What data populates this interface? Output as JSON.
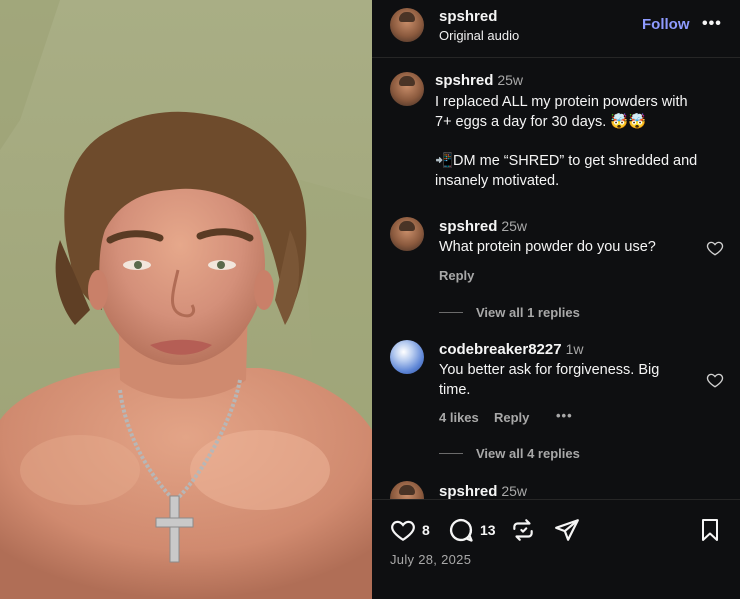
{
  "post": {
    "author": "spshred",
    "audio": "Original audio",
    "follow_label": "Follow",
    "caption_time": "25w",
    "caption_line1": "I replaced ALL my protein powders with",
    "caption_line2": "7+ eggs a day for 30 days. 🤯🤯",
    "caption_line3": "📲DM me “SHRED” to get shredded and",
    "caption_line4": "insanely motivated."
  },
  "comments": [
    {
      "username": "spshred",
      "time": "25w",
      "text": "What protein powder do you use?",
      "reply_label": "Reply",
      "view_replies": "View all 1 replies"
    },
    {
      "username": "codebreaker8227",
      "time": "1w",
      "text_line1": "You better ask for forgiveness. Big",
      "text_line2": "time.",
      "likes": "4 likes",
      "reply_label": "Reply",
      "more": "•••",
      "view_replies": "View all 4 replies"
    },
    {
      "username": "spshred",
      "time": "25w"
    }
  ],
  "actions": {
    "like_count": "8",
    "comment_count": "13",
    "icons": [
      "heart-icon",
      "comment-icon",
      "repost-icon",
      "share-icon",
      "save-icon"
    ]
  },
  "date": "July 28, 2025",
  "more_dots": "•••",
  "colors": {
    "follow": "#8e9bff",
    "panel_bg": "#0e0f11",
    "muted": "#a8a8a8",
    "wall": "#a7ad83",
    "skin": "#d9967a"
  }
}
